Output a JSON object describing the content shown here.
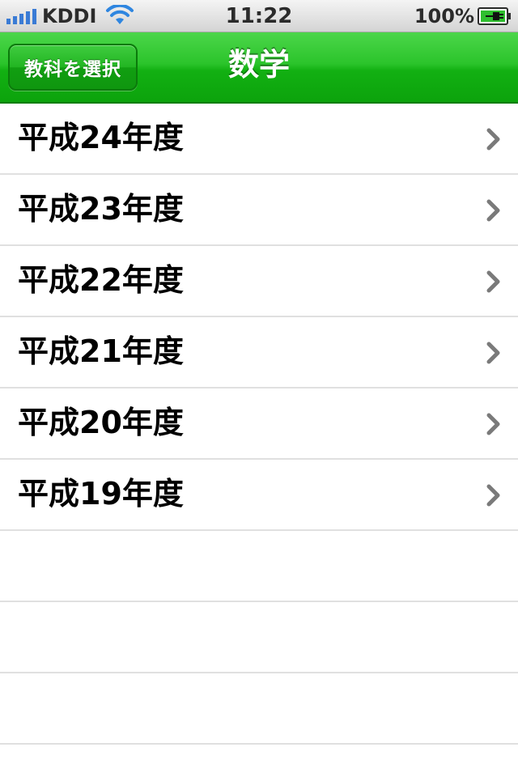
{
  "status_bar": {
    "carrier": "KDDI",
    "time": "11:22",
    "battery": "100%",
    "icons": [
      "signal-bars-icon",
      "wifi-icon",
      "battery-charging-icon"
    ]
  },
  "nav_bar": {
    "back_label": "教科を選択",
    "title": "数学",
    "accent_color": "#1fb81f"
  },
  "list": {
    "items": [
      {
        "label": "平成24年度"
      },
      {
        "label": "平成23年度"
      },
      {
        "label": "平成22年度"
      },
      {
        "label": "平成21年度"
      },
      {
        "label": "平成20年度"
      },
      {
        "label": "平成19年度"
      }
    ],
    "row_icon": "chevron-right-icon"
  }
}
